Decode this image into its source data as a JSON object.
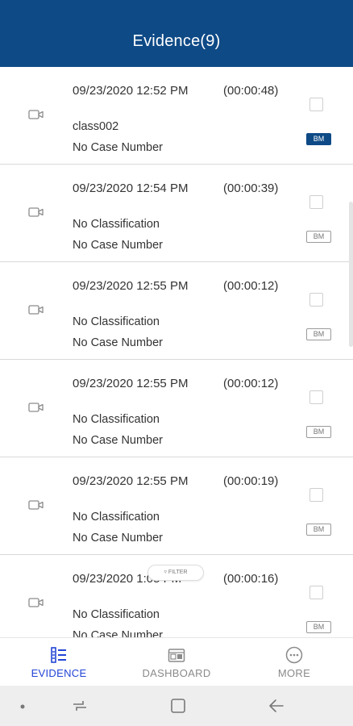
{
  "header": {
    "title": "Evidence(9)"
  },
  "items": [
    {
      "datetime": "09/23/2020 12:52 PM",
      "duration": "(00:00:48)",
      "classification": "class002",
      "case": "No Case Number",
      "bm": "BM",
      "bm_active": true
    },
    {
      "datetime": "09/23/2020 12:54 PM",
      "duration": "(00:00:39)",
      "classification": "No Classification",
      "case": "No Case Number",
      "bm": "BM",
      "bm_active": false
    },
    {
      "datetime": "09/23/2020 12:55 PM",
      "duration": "(00:00:12)",
      "classification": "No Classification",
      "case": "No Case Number",
      "bm": "BM",
      "bm_active": false
    },
    {
      "datetime": "09/23/2020 12:55 PM",
      "duration": "(00:00:12)",
      "classification": "No Classification",
      "case": "No Case Number",
      "bm": "BM",
      "bm_active": false
    },
    {
      "datetime": "09/23/2020 12:55 PM",
      "duration": "(00:00:19)",
      "classification": "No Classification",
      "case": "No Case Number",
      "bm": "BM",
      "bm_active": false
    },
    {
      "datetime": "09/23/2020 1:05 PM",
      "duration": "(00:00:16)",
      "classification": "No Classification",
      "case": "No Case Number",
      "bm": "BM",
      "bm_active": false
    }
  ],
  "filter": {
    "label": "FILTER"
  },
  "tabs": [
    {
      "label": "EVIDENCE",
      "icon": "evidence-list-icon",
      "active": true
    },
    {
      "label": "DASHBOARD",
      "icon": "dashboard-icon",
      "active": false
    },
    {
      "label": "MORE",
      "icon": "more-icon",
      "active": false
    }
  ],
  "system_nav": {
    "icons": [
      "dot-icon",
      "recents-icon",
      "home-icon",
      "back-icon"
    ]
  },
  "colors": {
    "header": "#0e4a86",
    "active_tab": "#2244d6",
    "bm_active": "#0e4a86"
  }
}
